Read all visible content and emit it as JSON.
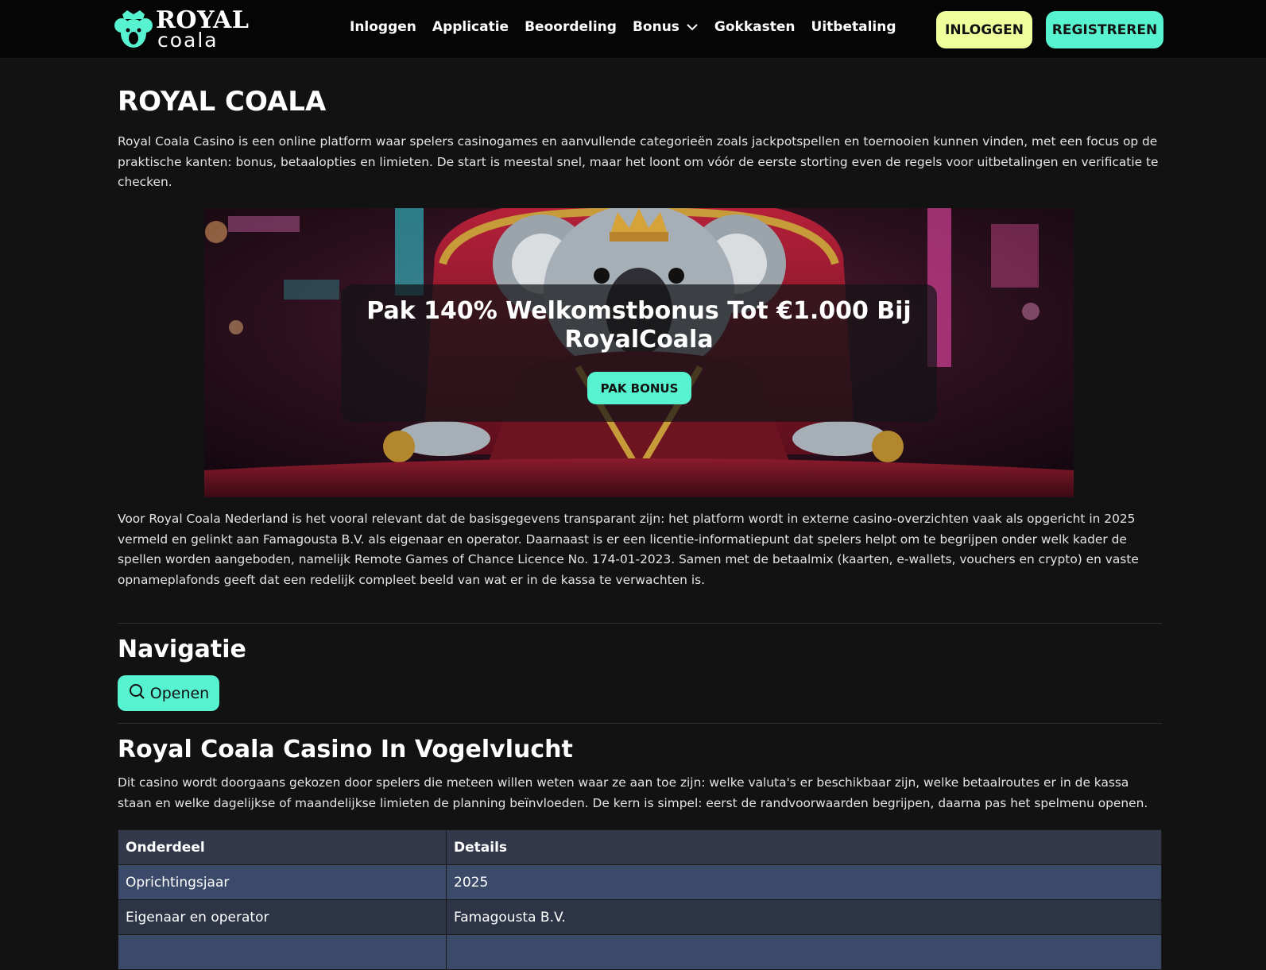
{
  "header": {
    "logo_top": "ROYAL",
    "logo_bottom": "coala",
    "nav": [
      {
        "label": "Inloggen"
      },
      {
        "label": "Applicatie"
      },
      {
        "label": "Beoordeling"
      },
      {
        "label": "Bonus",
        "icon": "chevron-down-icon"
      },
      {
        "label": "Gokkasten"
      },
      {
        "label": "Uitbetaling"
      }
    ],
    "login_label": "INLOGGEN",
    "register_label": "REGISTREREN"
  },
  "colors": {
    "accent": "#57f2cf",
    "login_button": "#eeff9b",
    "background": "#121212",
    "header_background": "#050505",
    "table_header": "#33394a",
    "table_row": "#3b4a68"
  },
  "main": {
    "title": "ROYAL COALA",
    "intro": "Royal Coala Casino is een online platform waar spelers casinogames en aanvullende categorieën zoals jackpotspellen en toernooien kunnen vinden, met een focus op de praktische kanten: bonus, betaalopties en limieten. De start is meestal snel, maar het loont om vóór de eerste storting even de regels voor uitbetalingen en verificatie te checken.",
    "hero": {
      "title": "Pak 140% Welkomstbonus Tot €1.000 Bij RoyalCoala",
      "button": "PAK BONUS"
    },
    "paragraph2": "Voor Royal Coala Nederland is het vooral relevant dat de basisgegevens transparant zijn: het platform wordt in externe casino-overzichten vaak als opgericht in 2025 vermeld en gelinkt aan Famagousta B.V. als eigenaar en operator. Daarnaast is er een licentie-informatiepunt dat spelers helpt om te begrijpen onder welk kader de spellen worden aangeboden, namelijk Remote Games of Chance Licence No. 174-01-2023. Samen met de betaalmix (kaarten, e-wallets, vouchers en crypto) en vaste opnameplafonds geeft dat een redelijk compleet beeld van wat er in de kassa te verwachten is.",
    "navigation": {
      "heading": "Navigatie",
      "button": "Openen",
      "icon": "search-icon"
    },
    "overview": {
      "heading": "Royal Coala Casino In Vogelvlucht",
      "text": "Dit casino wordt doorgaans gekozen door spelers die meteen willen weten waar ze aan toe zijn: welke valuta's er beschikbaar zijn, welke betaalroutes er in de kassa staan en welke dagelijkse of maandelijkse limieten de planning beïnvloeden. De kern is simpel: eerst de randvoorwaarden begrijpen, daarna pas het spelmenu openen.",
      "table": {
        "headers": [
          "Onderdeel",
          "Details"
        ],
        "rows": [
          [
            "Oprichtingsjaar",
            "2025"
          ],
          [
            "Eigenaar en operator",
            "Famagousta B.V."
          ],
          [
            "",
            ""
          ]
        ]
      }
    }
  }
}
